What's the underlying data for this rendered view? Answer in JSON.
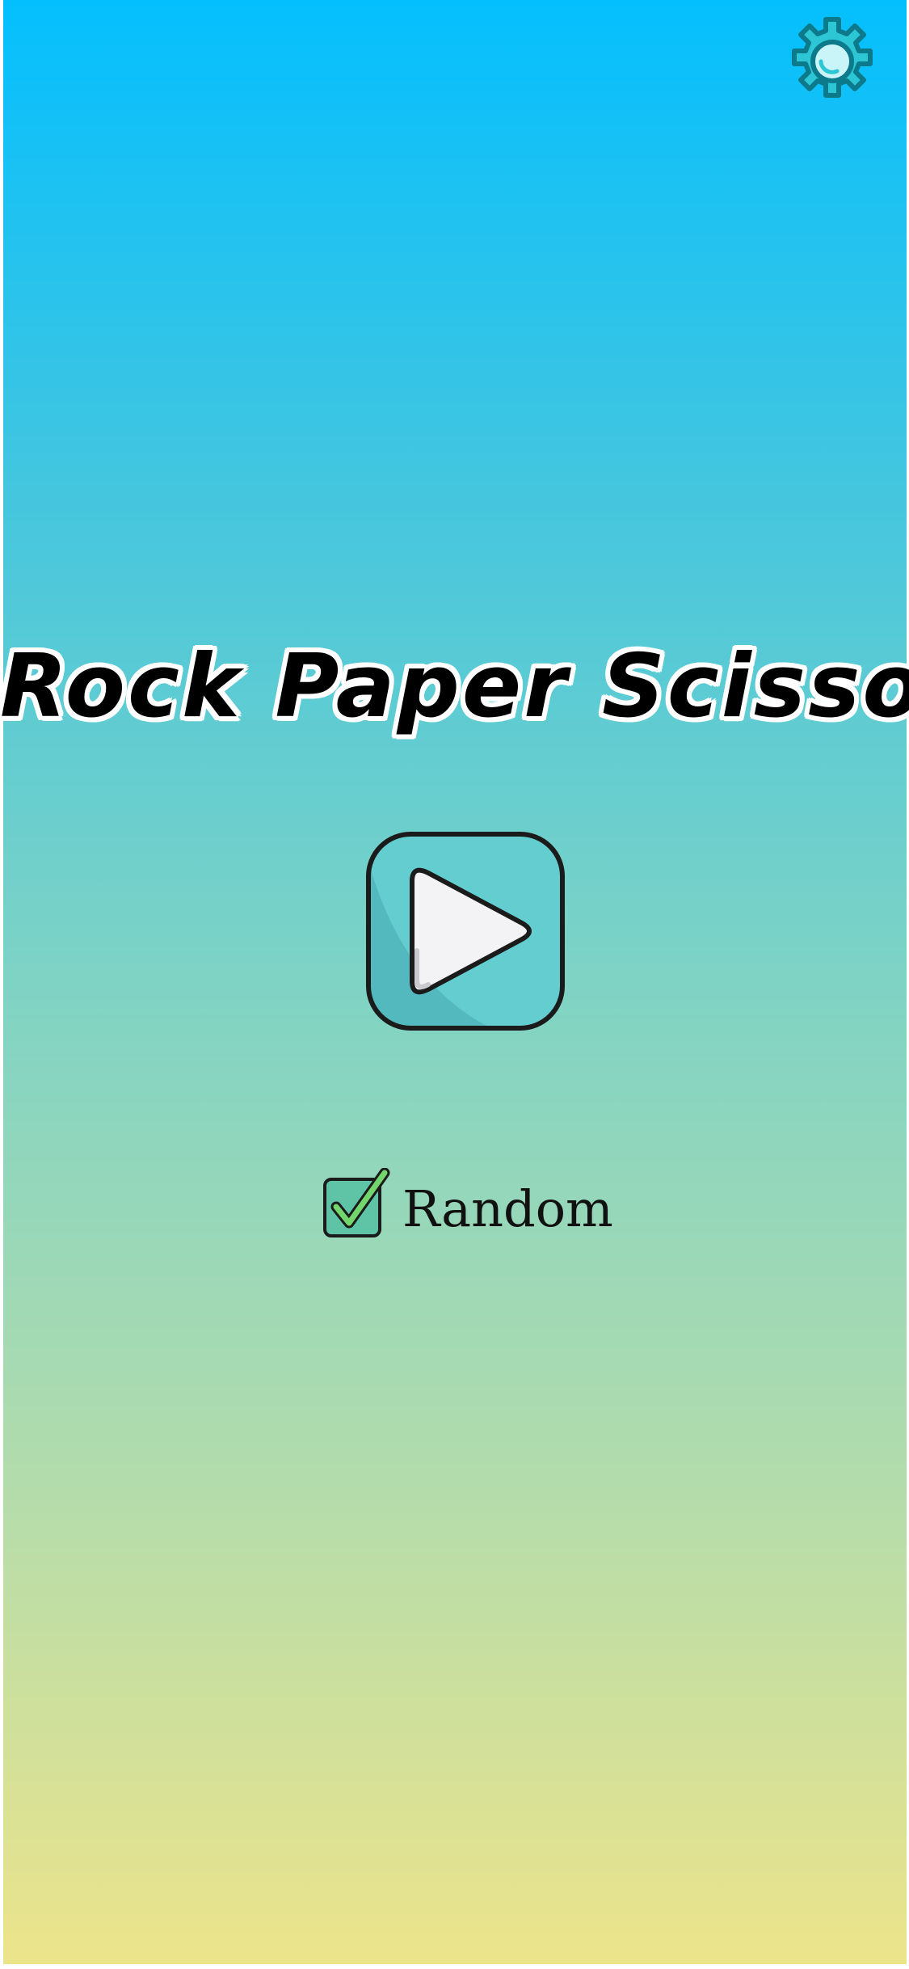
{
  "app": {
    "title": "Rock Paper Scissors"
  },
  "settings": {
    "icon": "gear-icon"
  },
  "play": {
    "icon": "play-icon"
  },
  "random": {
    "label": "Random",
    "checked": true
  },
  "colors": {
    "background_top": "#04bffe",
    "background_bottom": "#ede48a",
    "gear_fill": "#2cc6d4",
    "gear_outline": "#0d7a8c",
    "gear_center": "#c9f5f8",
    "play_tile": "#64cdd0",
    "play_tile_shade": "#4fb2b8",
    "play_triangle": "#f3f3f5",
    "check_green": "#72d66d"
  }
}
